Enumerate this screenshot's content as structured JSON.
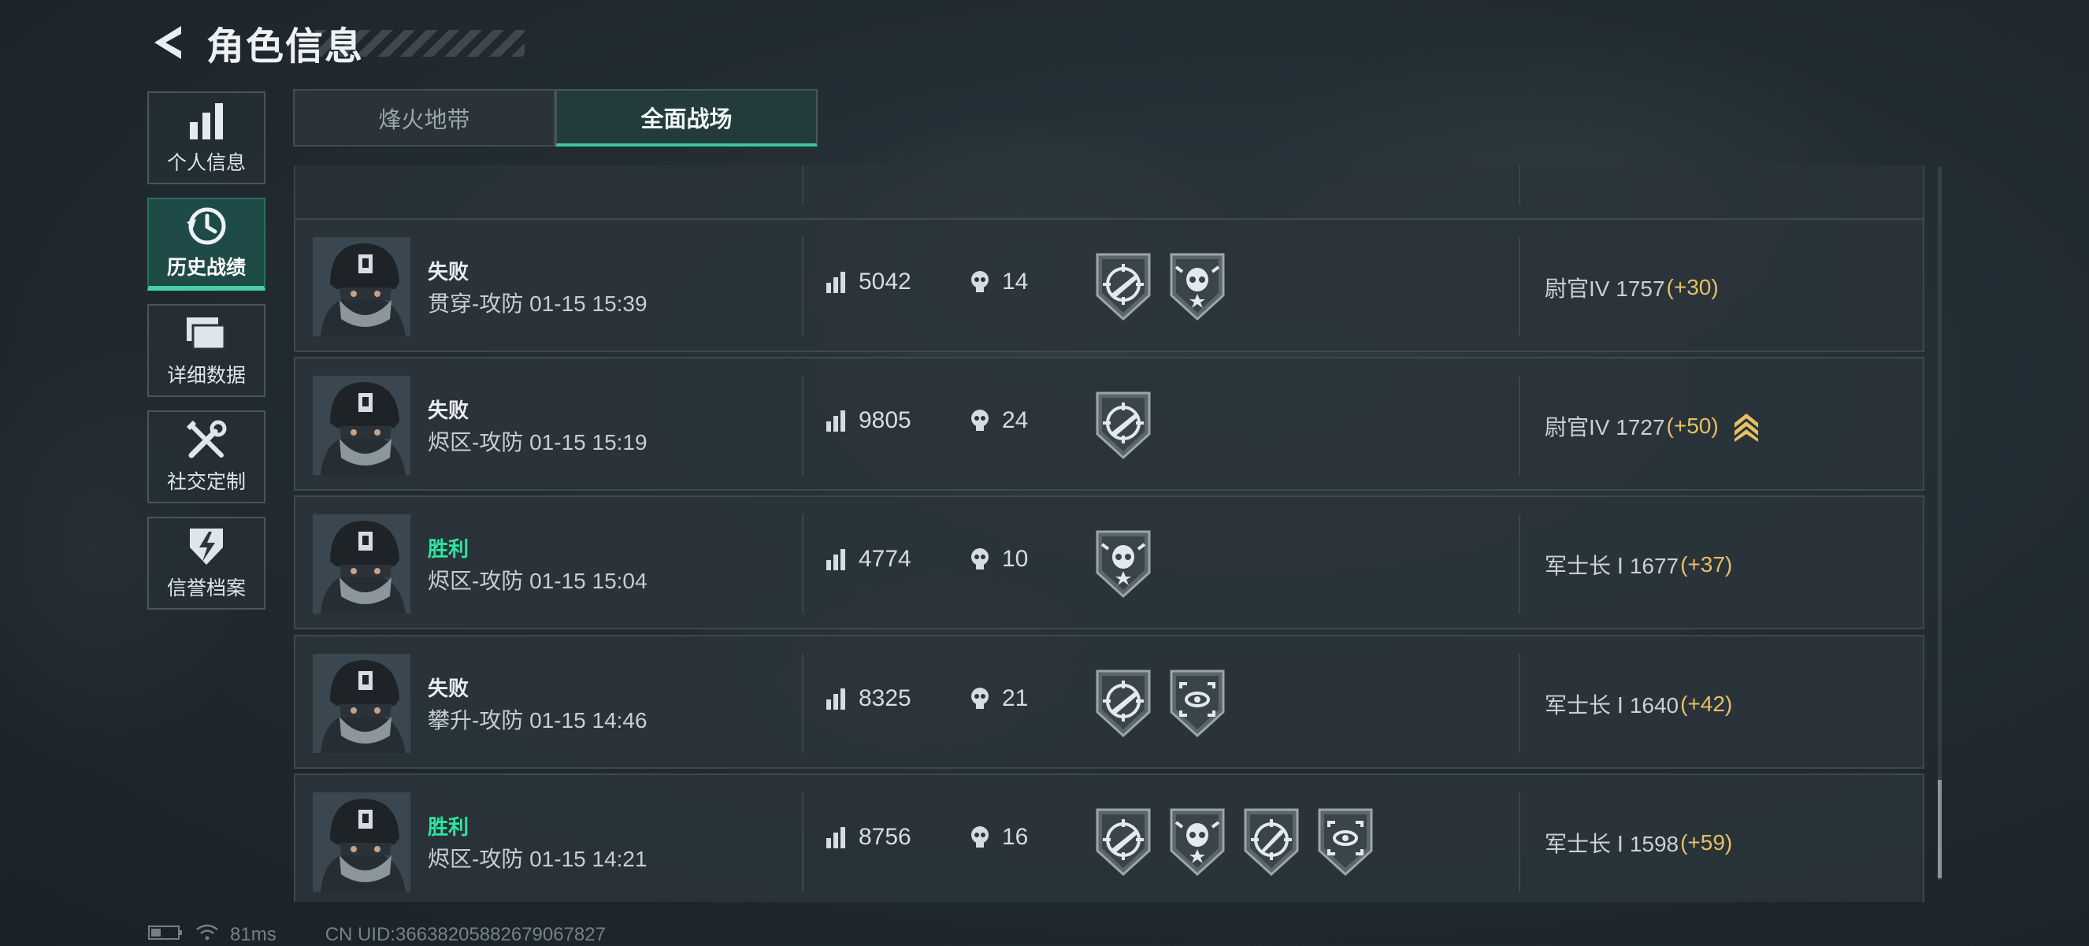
{
  "header": {
    "title": "角色信息"
  },
  "sidebar": {
    "items": [
      {
        "label": "个人信息",
        "icon": "bar-chart-icon",
        "active": false
      },
      {
        "label": "历史战绩",
        "icon": "history-clock-icon",
        "active": true
      },
      {
        "label": "详细数据",
        "icon": "stacked-cards-icon",
        "active": false
      },
      {
        "label": "社交定制",
        "icon": "tools-icon",
        "active": false
      },
      {
        "label": "信誉档案",
        "icon": "lightning-shield-icon",
        "active": false
      }
    ]
  },
  "tabs": [
    {
      "label": "烽火地带",
      "active": false
    },
    {
      "label": "全面战场",
      "active": true
    }
  ],
  "matches": [
    {
      "result": "失败",
      "win": false,
      "mode": "贯穿-攻防 01-15 15:39",
      "score": "5042",
      "kills": "14",
      "badges": [
        "crosshair-rifle-badge",
        "skull-star-badge"
      ],
      "rank": "尉官IV 1757",
      "points": "(+30)",
      "promoted": false
    },
    {
      "result": "失败",
      "win": false,
      "mode": "烬区-攻防 01-15 15:19",
      "score": "9805",
      "kills": "24",
      "badges": [
        "crosshair-rifle-badge"
      ],
      "rank": "尉官IV 1727",
      "points": "(+50)",
      "promoted": true
    },
    {
      "result": "胜利",
      "win": true,
      "mode": "烬区-攻防 01-15 15:04",
      "score": "4774",
      "kills": "10",
      "badges": [
        "skull-star-badge"
      ],
      "rank": "军士长 Ⅰ 1677",
      "points": "(+37)",
      "promoted": false
    },
    {
      "result": "失败",
      "win": false,
      "mode": "攀升-攻防 01-15 14:46",
      "score": "8325",
      "kills": "21",
      "badges": [
        "crosshair-rifle-badge",
        "eye-scope-badge"
      ],
      "rank": "军士长 Ⅰ 1640",
      "points": "(+42)",
      "promoted": false
    },
    {
      "result": "胜利",
      "win": true,
      "mode": "烬区-攻防 01-15 14:21",
      "score": "8756",
      "kills": "16",
      "badges": [
        "crosshair-rifle-badge",
        "skull-star-badge",
        "crosshair-knife-badge",
        "eye-scope-badge"
      ],
      "rank": "军士长 Ⅰ 1598",
      "points": "(+59)",
      "promoted": false
    }
  ],
  "footer": {
    "ping": "81ms",
    "uid": "CN UID:366382058826790​67827"
  },
  "colors": {
    "accent": "#45d3a5",
    "win": "#2ee5a0",
    "points": "#e8c062"
  }
}
